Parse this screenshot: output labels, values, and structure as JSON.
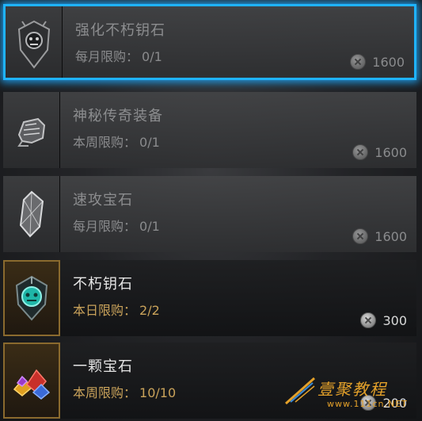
{
  "shop": {
    "items": [
      {
        "name": "强化不朽钥石",
        "limit_label": "每月限购：",
        "limit_value": "0/1",
        "price": "1600",
        "icon": "crest-key-icon",
        "state": "locked-selected"
      },
      {
        "name": "神秘传奇装备",
        "limit_label": "本周限购：",
        "limit_value": "0/1",
        "price": "1600",
        "icon": "gauntlet-icon",
        "state": "locked"
      },
      {
        "name": "速攻宝石",
        "limit_label": "每月限购：",
        "limit_value": "0/1",
        "price": "1600",
        "icon": "crystal-gem-icon",
        "state": "locked"
      },
      {
        "name": "不朽钥石",
        "limit_label": "本日限购：",
        "limit_value": "2/2",
        "price": "300",
        "icon": "teal-crest-key-icon",
        "state": "available"
      },
      {
        "name": "一颗宝石",
        "limit_label": "本周限购：",
        "limit_value": "10/10",
        "price": "200",
        "icon": "gem-pile-icon",
        "state": "available"
      }
    ],
    "currency_icon": "silver-coin-icon"
  },
  "watermark": {
    "brand": "壹聚教程",
    "site": "www.111cn.NET"
  },
  "colors": {
    "selection": "#1fb3ff",
    "limit_text": "#c9a25a",
    "watermark": "#e4a12a"
  }
}
